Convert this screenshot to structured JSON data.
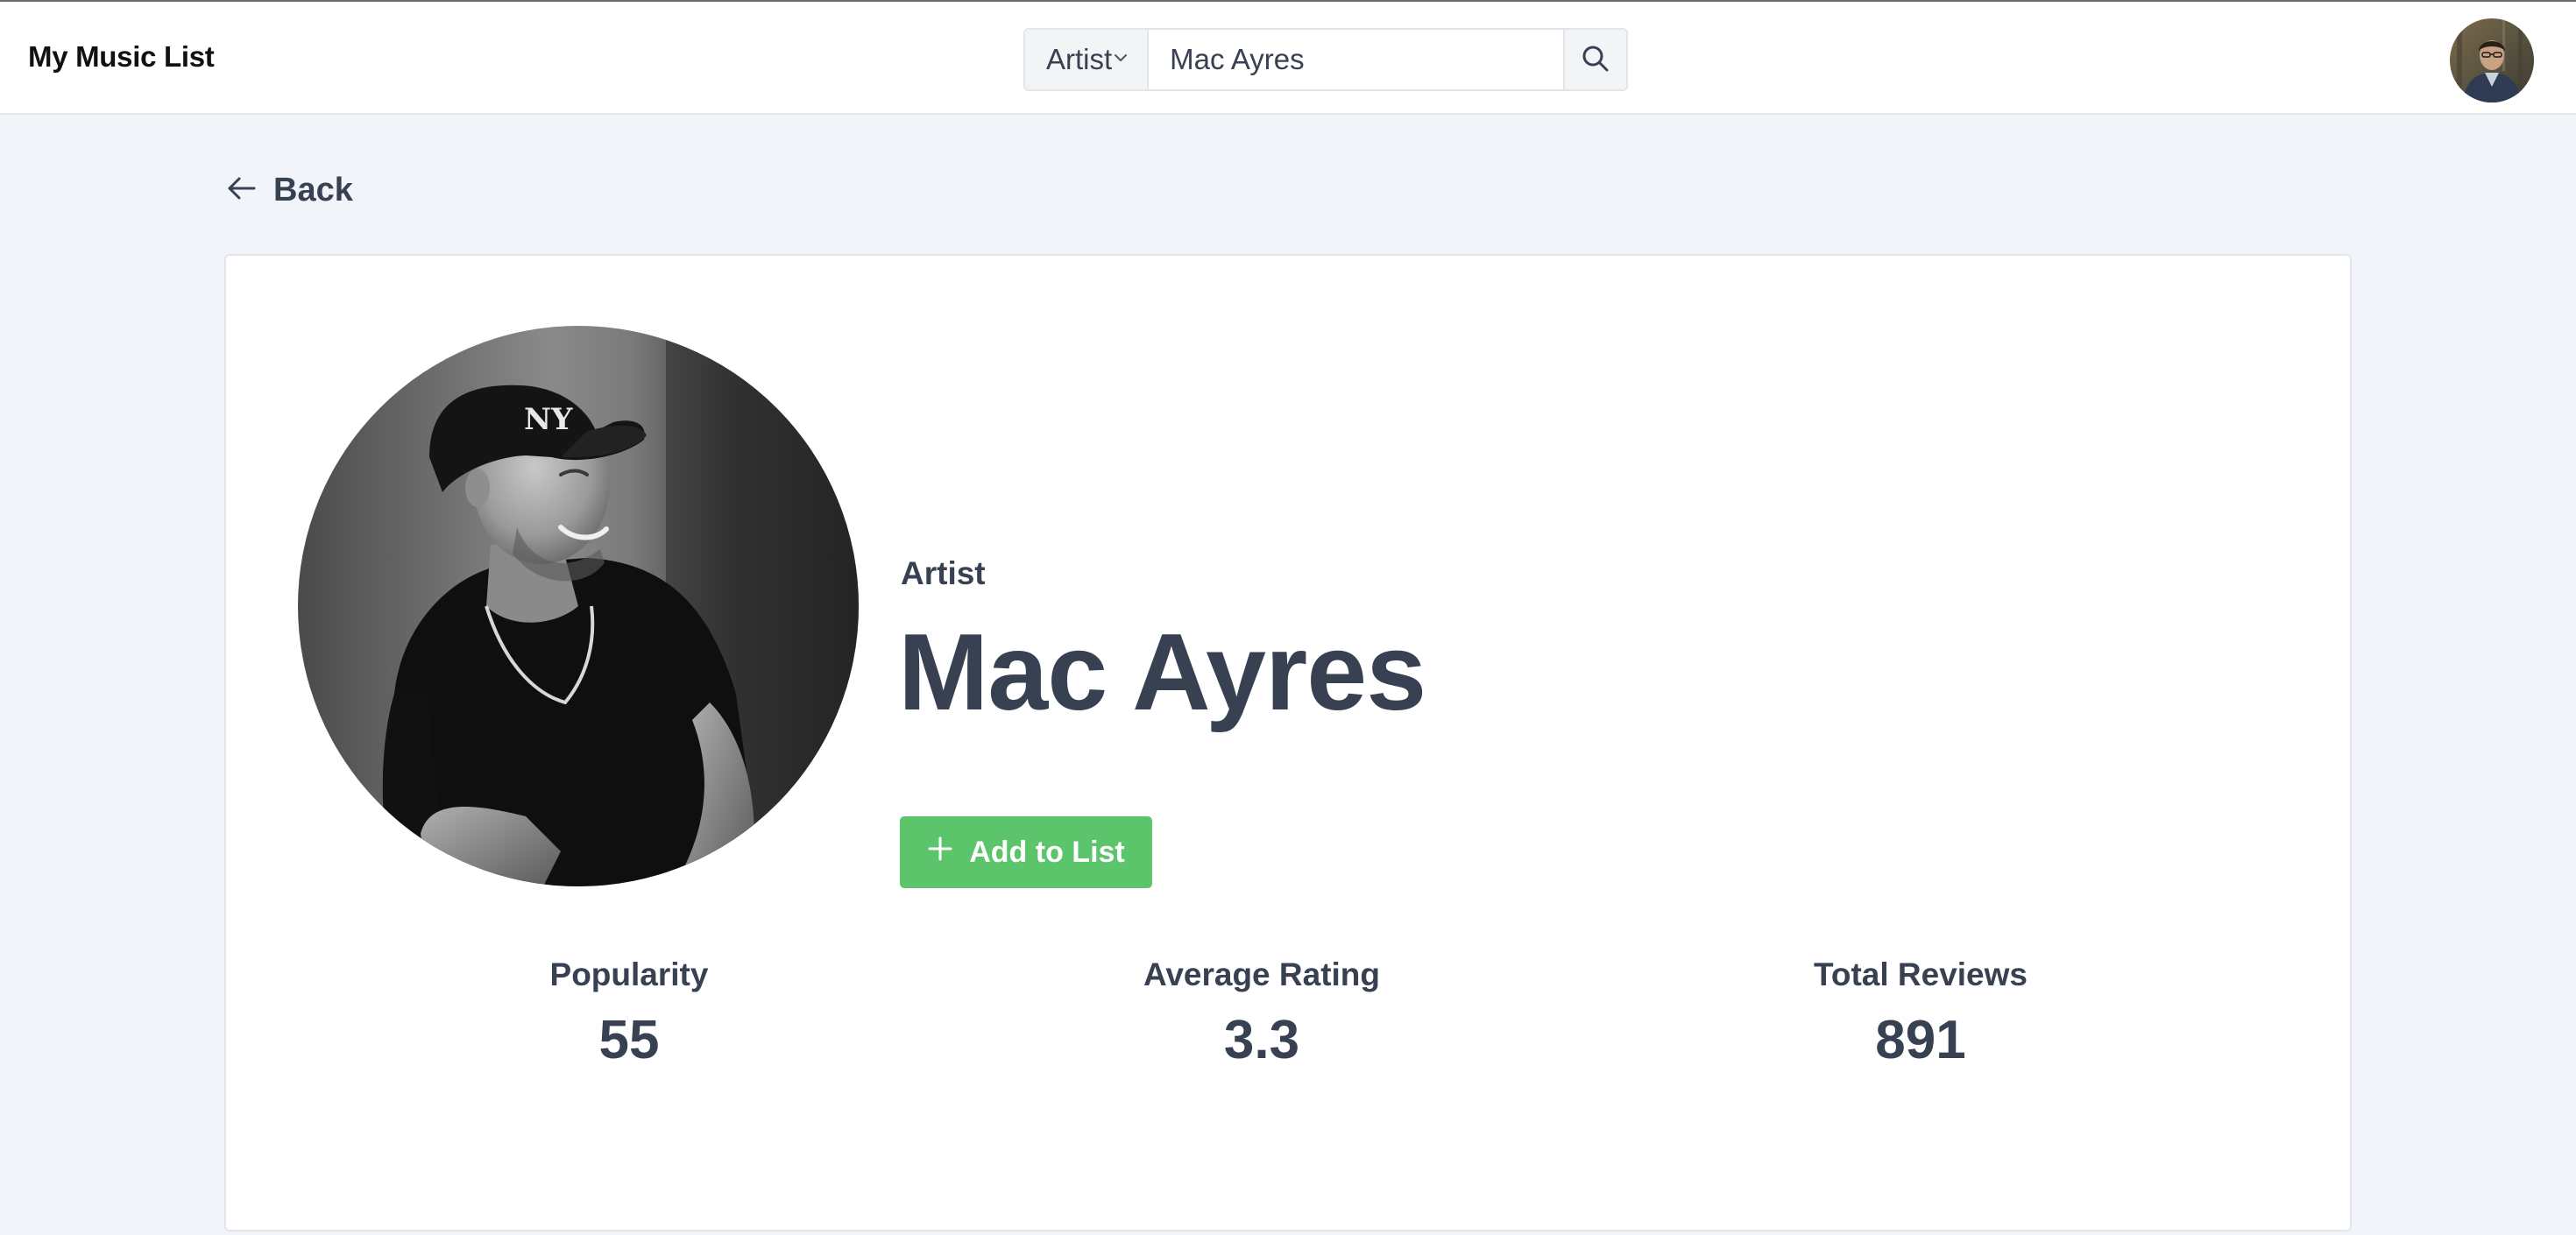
{
  "header": {
    "app_title": "My Music List",
    "search": {
      "type_selected": "Artist",
      "query": "Mac Ayres"
    }
  },
  "back": {
    "label": "Back"
  },
  "artist": {
    "kind_label": "Artist",
    "name": "Mac Ayres",
    "add_button_label": "Add to List"
  },
  "stats": [
    {
      "label": "Popularity",
      "value": "55"
    },
    {
      "label": "Average Rating",
      "value": "3.3"
    },
    {
      "label": "Total Reviews",
      "value": "891"
    }
  ],
  "colors": {
    "page_background": "#f1f4f8",
    "card_background": "#ffffff",
    "text": "#374151",
    "add_button": "#5cc56c"
  },
  "icons": {
    "search": "search-icon",
    "dropdown": "chevron-down-icon",
    "back": "arrow-left-icon",
    "add": "plus-icon"
  }
}
